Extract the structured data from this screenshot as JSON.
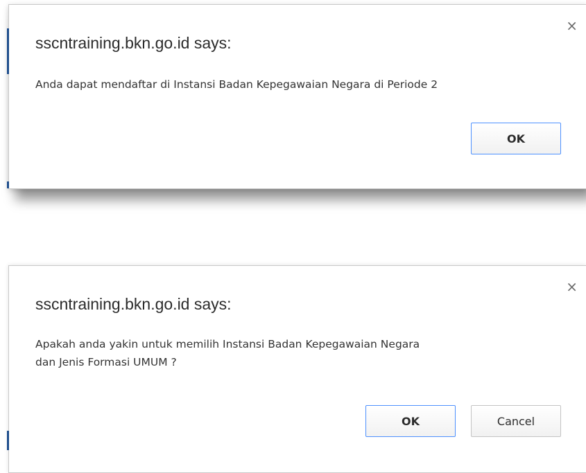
{
  "dialogs": [
    {
      "title": "sscntraining.bkn.go.id says:",
      "close_icon": "×",
      "message_lines": [
        "Anda dapat mendaftar di Instansi Badan Kepegawaian Negara di Periode 2"
      ],
      "buttons": {
        "ok": "OK"
      }
    },
    {
      "title": "sscntraining.bkn.go.id says:",
      "close_icon": "×",
      "message_lines": [
        "Apakah anda yakin untuk memilih Instansi Badan Kepegawaian Negara",
        "dan Jenis Formasi UMUM ?"
      ],
      "buttons": {
        "ok": "OK",
        "cancel": "Cancel"
      }
    }
  ],
  "colors": {
    "focus_border": "#4d90fe",
    "left_strip": "#1e4d8c"
  },
  "icons": {
    "close": "close-icon"
  }
}
